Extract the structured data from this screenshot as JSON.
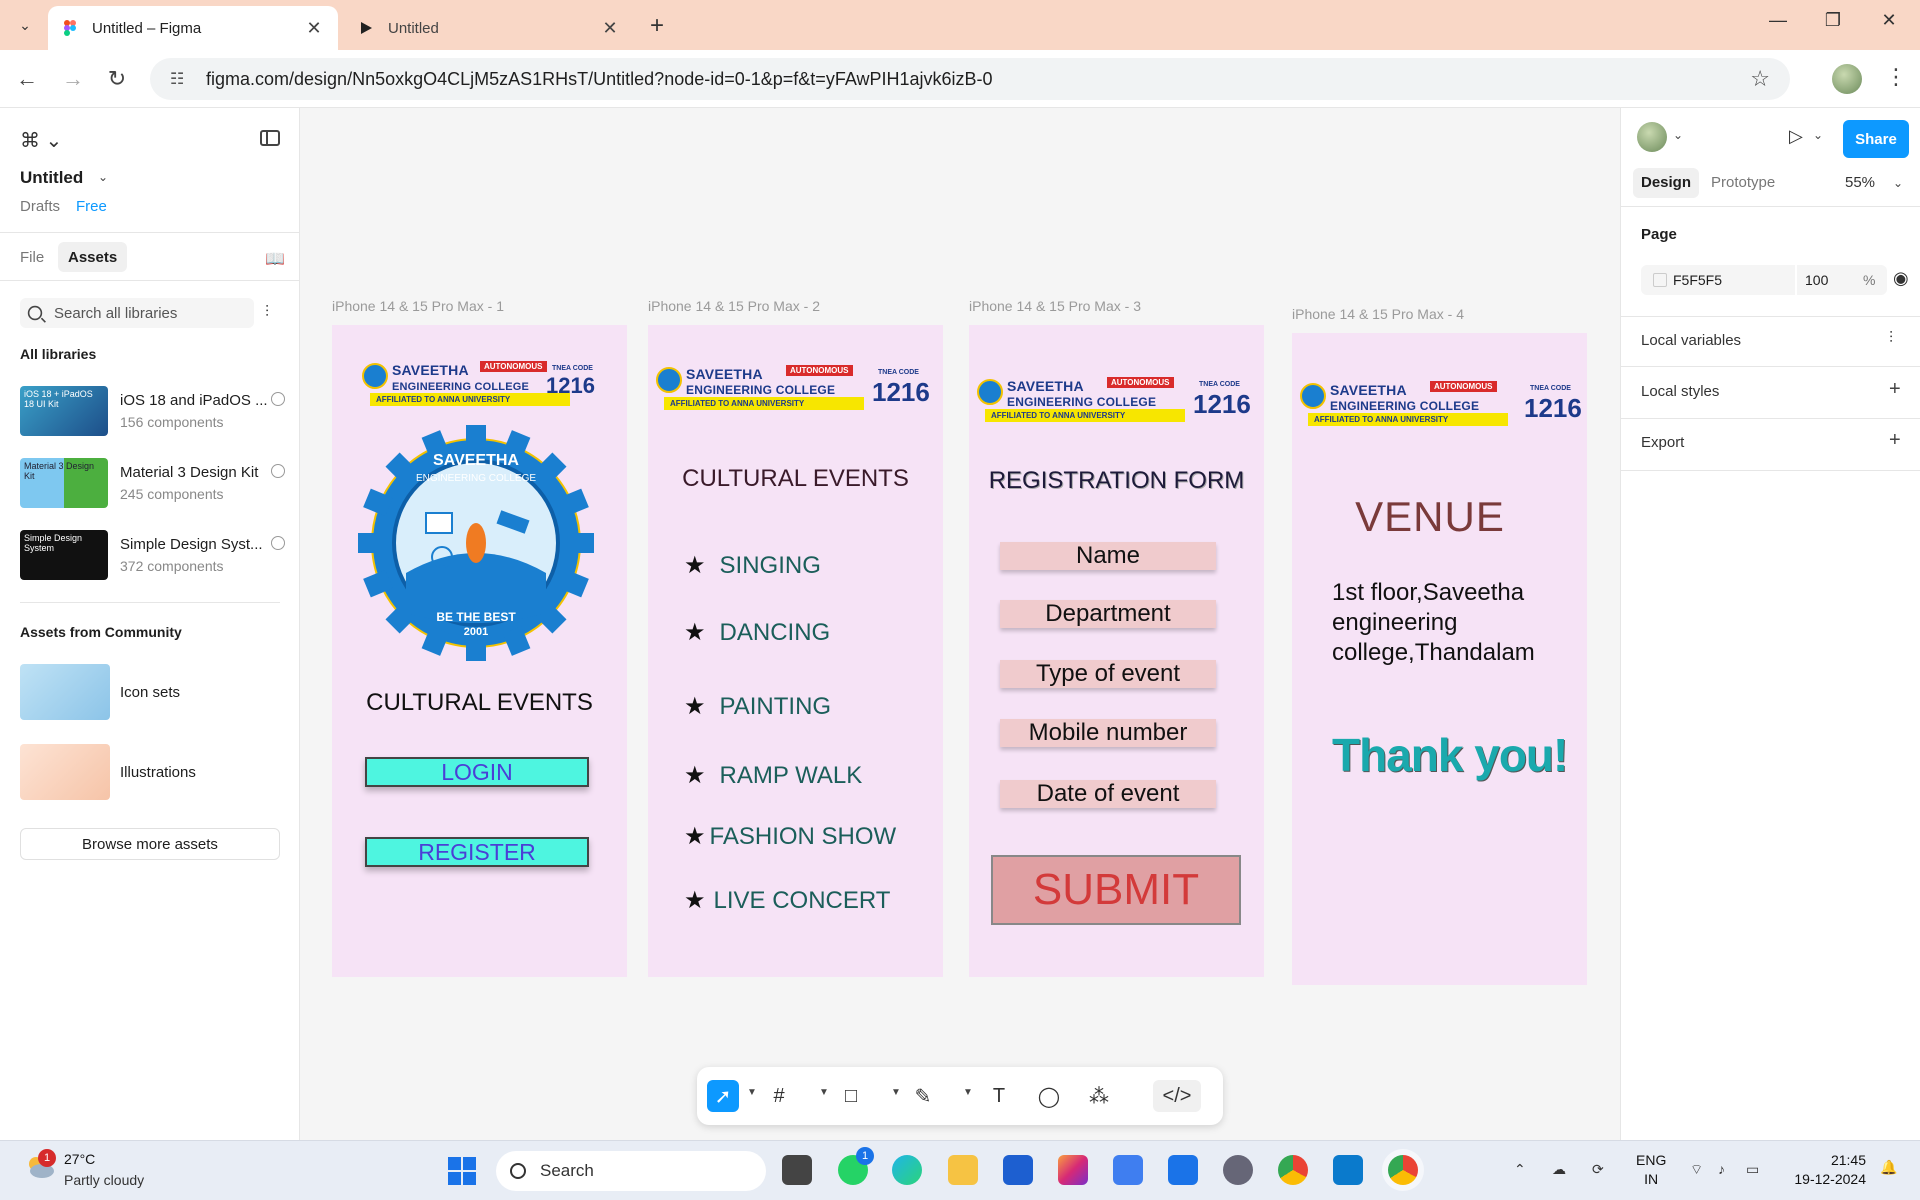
{
  "browser": {
    "tabs": [
      {
        "title": "Untitled – Figma",
        "active": true
      },
      {
        "title": "Untitled",
        "active": false
      }
    ],
    "url": "figma.com/design/Nn5oxkgO4CLjM5zAS1RHsT/Untitled?node-id=0-1&p=f&t=yFAwPIH1ajvk6izB-0",
    "controls": {
      "minimize": "—",
      "maximize": "❐",
      "close": "✕"
    }
  },
  "left_panel": {
    "file_title": "Untitled",
    "drafts": "Drafts",
    "plan": "Free",
    "tabs": {
      "file": "File",
      "assets": "Assets"
    },
    "search_placeholder": "Search all libraries",
    "all_libraries_heading": "All libraries",
    "libraries": [
      {
        "name": "iOS 18 and iPadOS ...",
        "count": "156 components",
        "thumb_text": "iOS 18 + iPadOS 18 UI Kit"
      },
      {
        "name": "Material 3 Design Kit",
        "count": "245 components",
        "thumb_text": "Material 3 Design Kit"
      },
      {
        "name": "Simple Design Syst...",
        "count": "372 components",
        "thumb_text": "Simple Design System"
      }
    ],
    "community_heading": "Assets from Community",
    "community": [
      {
        "name": "Icon sets"
      },
      {
        "name": "Illustrations"
      }
    ],
    "browse_button": "Browse more assets"
  },
  "right_panel": {
    "share": "Share",
    "tabs": {
      "design": "Design",
      "prototype": "Prototype"
    },
    "zoom": "55%",
    "page_heading": "Page",
    "page_fill": {
      "hex": "F5F5F5",
      "opacity": "100",
      "unit": "%"
    },
    "rows": [
      "Local variables",
      "Local styles",
      "Export"
    ]
  },
  "canvas": {
    "frame_labels": [
      "iPhone 14 & 15 Pro Max - 1",
      "iPhone 14 & 15 Pro Max - 2",
      "iPhone 14 & 15 Pro Max - 3",
      "iPhone 14 & 15 Pro Max - 4"
    ],
    "logo": {
      "line1": "SAVEETHA",
      "line2": "ENGINEERING COLLEGE",
      "autonomous": "AUTONOMOUS",
      "affiliated": "AFFILIATED TO ANNA UNIVERSITY",
      "tnea": "TNEA CODE",
      "code": "1216"
    },
    "emblem": {
      "name": "SAVEETHA",
      "sub": "ENGINEERING COLLEGE",
      "motto": "BE THE BEST",
      "year": "2001"
    },
    "frame1": {
      "heading": "CULTURAL EVENTS",
      "login": "LOGIN",
      "register": "REGISTER"
    },
    "frame2": {
      "heading": "CULTURAL EVENTS",
      "star": "★",
      "events": [
        "SINGING",
        "DANCING",
        "PAINTING",
        "RAMP WALK",
        "FASHION SHOW",
        "LIVE CONCERT"
      ]
    },
    "frame3": {
      "heading": "REGISTRATION FORM",
      "fields": [
        "Name",
        "Department",
        "Type of event",
        "Mobile number",
        "Date of event"
      ],
      "submit": "SUBMIT"
    },
    "frame4": {
      "title": "VENUE",
      "address": "1st floor,Saveetha engineering college,Thandalam",
      "thanks": "Thank you!"
    }
  },
  "help": "?",
  "taskbar": {
    "weather": {
      "temp": "27°C",
      "desc": "Partly cloudy",
      "badge": "1"
    },
    "search": "Search",
    "whatsapp_badge": "1",
    "lang": {
      "line1": "ENG",
      "line2": "IN"
    },
    "clock": {
      "time": "21:45",
      "date": "19-12-2024"
    }
  },
  "colors": {
    "accent": "#0d99ff",
    "frame_bg": "#f6e3f6",
    "button": "#4ef5e0",
    "field": "#f0cbcd",
    "submit": "#e0a0a3",
    "thanks": "#1aa9ad"
  }
}
